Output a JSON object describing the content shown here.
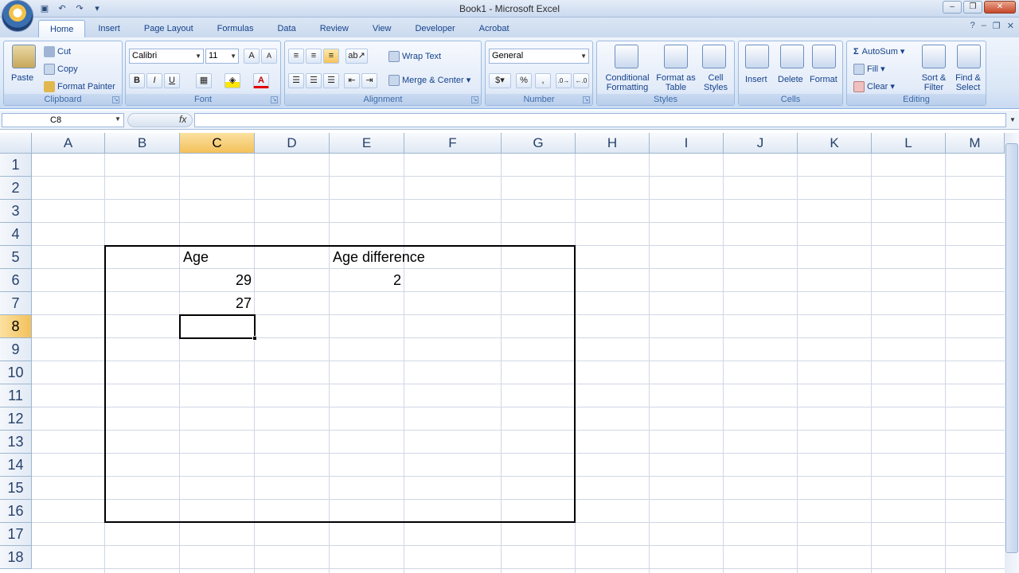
{
  "window": {
    "title": "Book1 - Microsoft Excel"
  },
  "quick_access": [
    "save-icon",
    "undo-icon",
    "redo-icon",
    "customize-icon"
  ],
  "tabs": [
    "Home",
    "Insert",
    "Page Layout",
    "Formulas",
    "Data",
    "Review",
    "View",
    "Developer",
    "Acrobat"
  ],
  "ribbon": {
    "clipboard": {
      "label": "Clipboard",
      "paste": "Paste",
      "cut": "Cut",
      "copy": "Copy",
      "format_painter": "Format Painter"
    },
    "font": {
      "label": "Font",
      "name": "Calibri",
      "size": "11",
      "bold": "B",
      "italic": "I",
      "underline": "U"
    },
    "alignment": {
      "label": "Alignment",
      "wrap_text": "Wrap Text",
      "merge_center": "Merge & Center"
    },
    "number": {
      "label": "Number",
      "format": "General",
      "percent": "%",
      "comma": ","
    },
    "styles": {
      "label": "Styles",
      "conditional": "Conditional Formatting",
      "format_table": "Format as Table",
      "cell_styles": "Cell Styles"
    },
    "cells": {
      "label": "Cells",
      "insert": "Insert",
      "delete": "Delete",
      "format": "Format"
    },
    "editing": {
      "label": "Editing",
      "autosum": "AutoSum",
      "fill": "Fill",
      "clear": "Clear",
      "sort_filter": "Sort & Filter",
      "find_select": "Find & Select"
    }
  },
  "formula_bar": {
    "name_box": "C8",
    "fx": "fx",
    "formula": ""
  },
  "sheet": {
    "columns": [
      "A",
      "B",
      "C",
      "D",
      "E",
      "F",
      "G",
      "H",
      "I",
      "J",
      "K",
      "L",
      "M"
    ],
    "selected_column": "C",
    "rows": [
      "1",
      "2",
      "3",
      "4",
      "5",
      "6",
      "7",
      "8",
      "9",
      "10",
      "11",
      "12",
      "13",
      "14",
      "15",
      "16",
      "17",
      "18"
    ],
    "selected_row": "8",
    "active_cell": "C8",
    "cells": {
      "C5": "Age",
      "E5": "Age difference",
      "C6": "29",
      "E6": "2",
      "C7": "27"
    },
    "bordered_range": "B5:G16"
  }
}
